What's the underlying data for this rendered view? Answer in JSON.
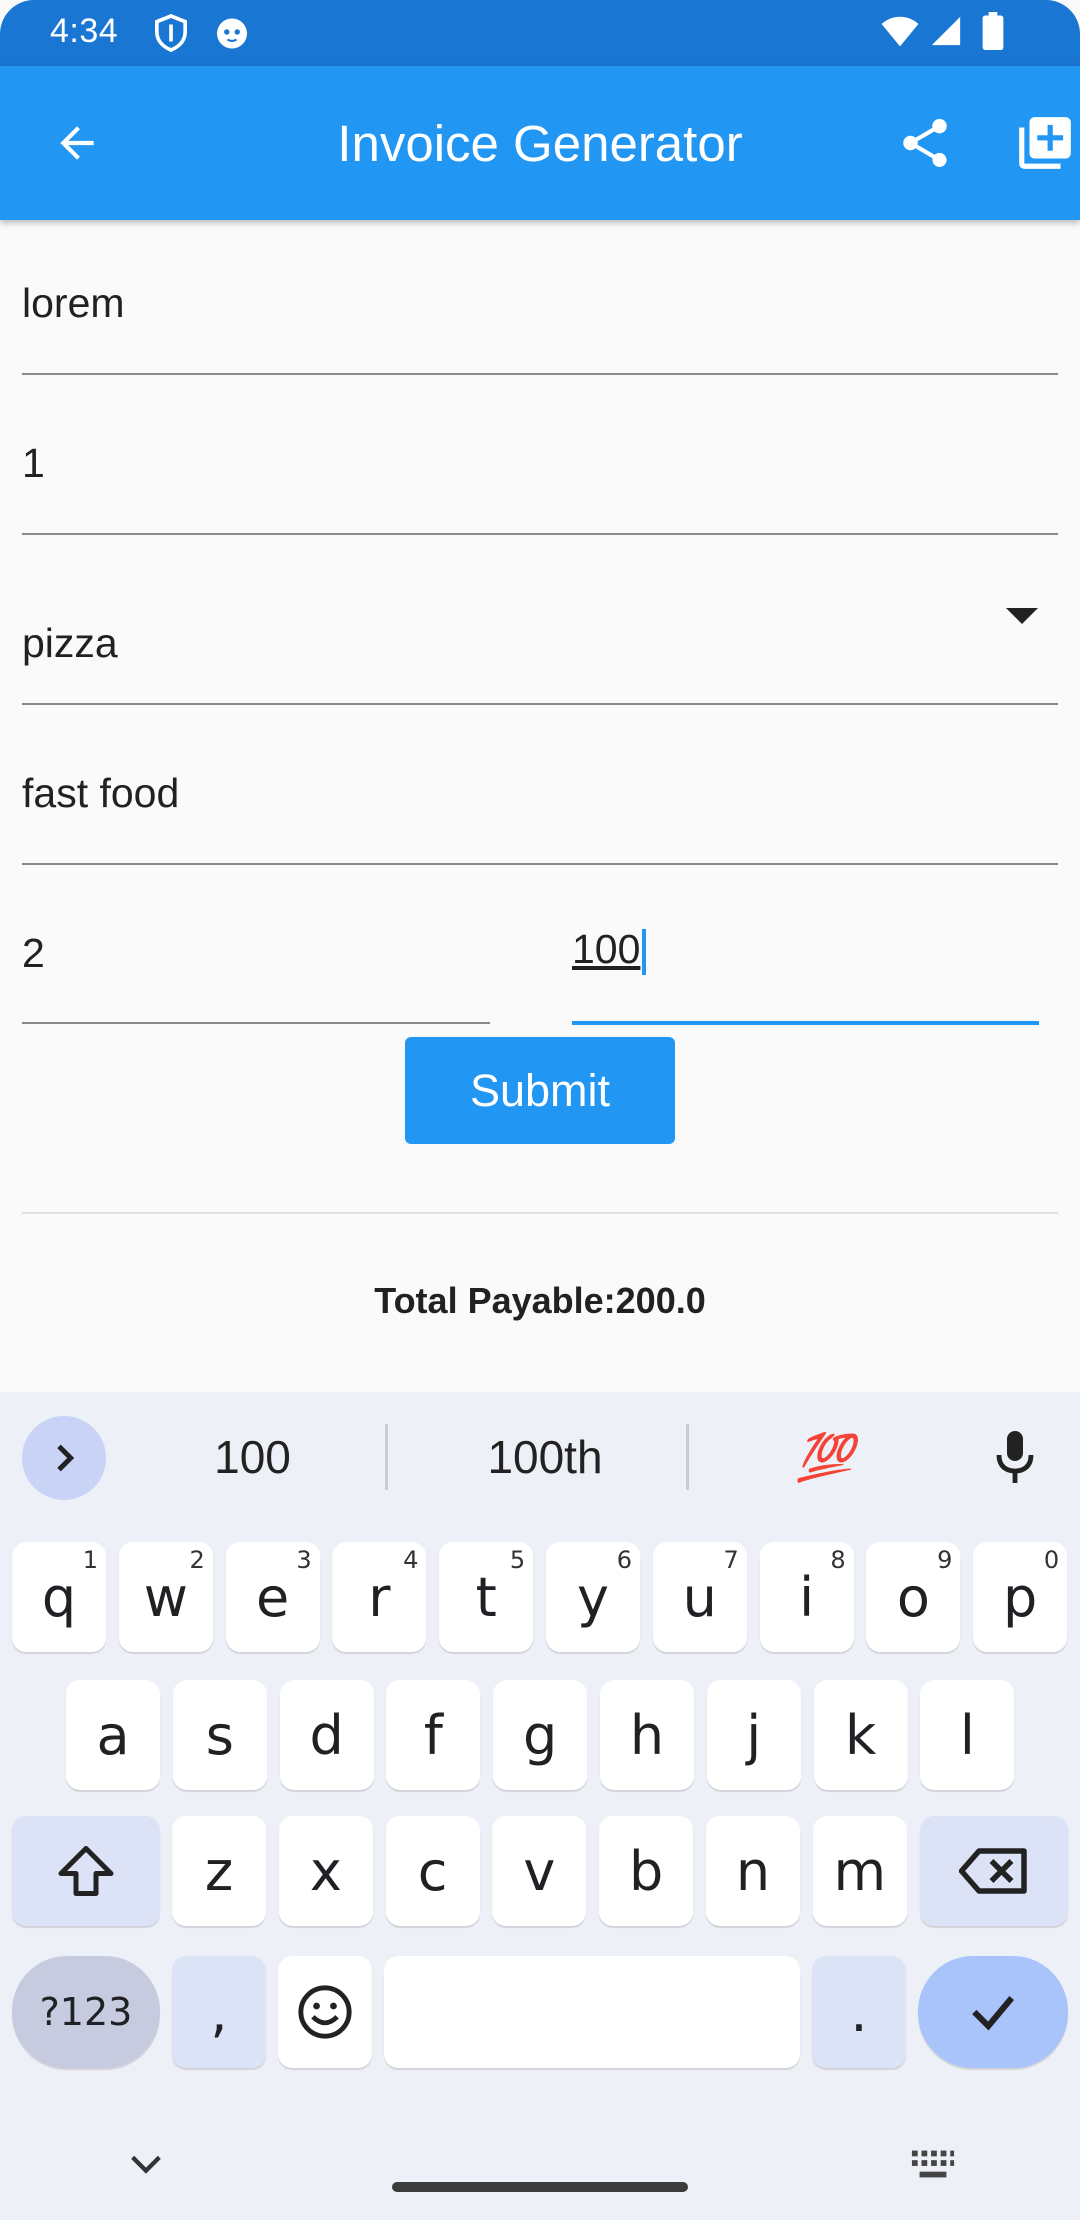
{
  "status_bar": {
    "time": "4:34"
  },
  "app_bar": {
    "title": "Invoice Generator"
  },
  "form": {
    "name_value": "lorem",
    "qty1_value": "1",
    "category_value": "pizza",
    "type_value": "fast food",
    "qty2_value": "2",
    "price_value": "100",
    "submit_label": "Submit",
    "total_label": "Total Payable:200.0"
  },
  "keyboard": {
    "suggestions": [
      "100",
      "100th"
    ],
    "emoji_suggestion": "💯",
    "row1": [
      {
        "k": "q",
        "h": "1"
      },
      {
        "k": "w",
        "h": "2"
      },
      {
        "k": "e",
        "h": "3"
      },
      {
        "k": "r",
        "h": "4"
      },
      {
        "k": "t",
        "h": "5"
      },
      {
        "k": "y",
        "h": "6"
      },
      {
        "k": "u",
        "h": "7"
      },
      {
        "k": "i",
        "h": "8"
      },
      {
        "k": "o",
        "h": "9"
      },
      {
        "k": "p",
        "h": "0"
      }
    ],
    "row2": [
      "a",
      "s",
      "d",
      "f",
      "g",
      "h",
      "j",
      "k",
      "l"
    ],
    "row3": [
      "z",
      "x",
      "c",
      "v",
      "b",
      "n",
      "m"
    ],
    "sym_label": "?123",
    "comma_label": ",",
    "period_label": "."
  },
  "colors": {
    "primary": "#2196f3",
    "status_bar": "#1976d2",
    "keyboard_bg": "#eef0f7"
  }
}
